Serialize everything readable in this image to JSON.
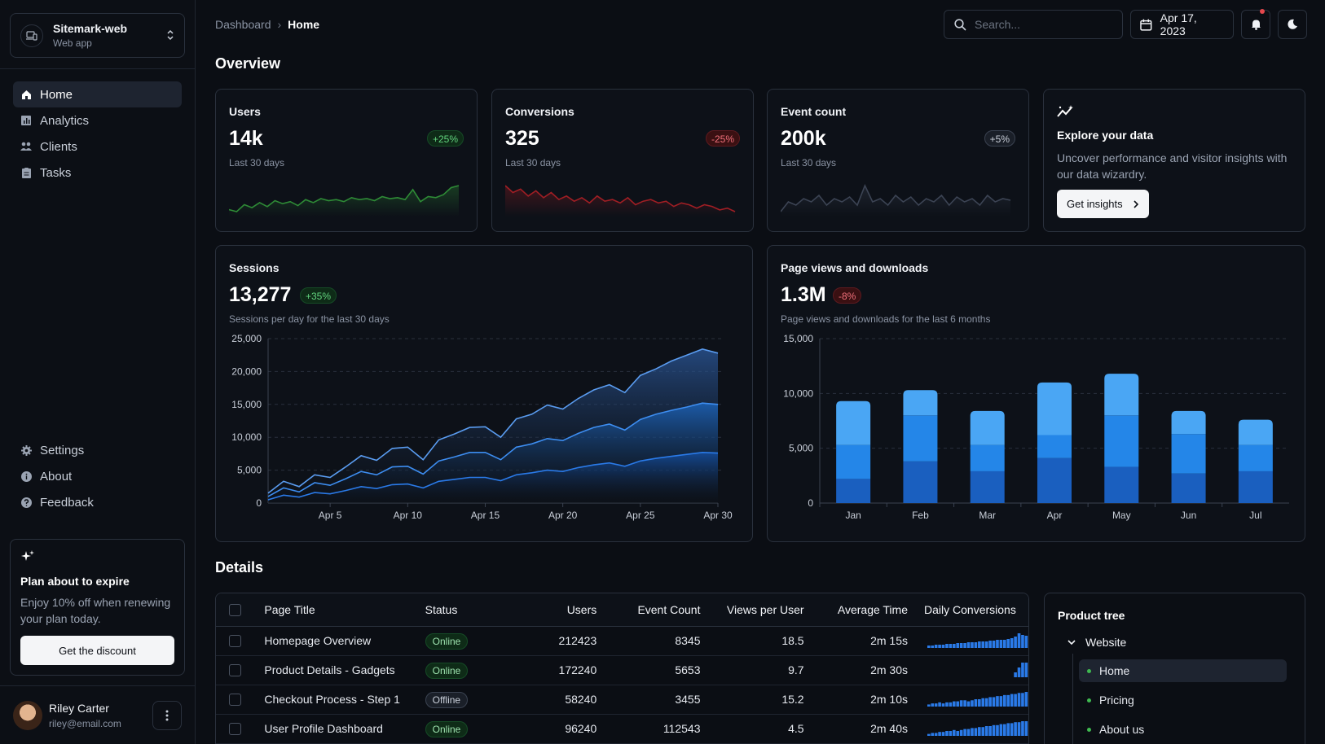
{
  "app": {
    "name": "Sitemark-web",
    "subtitle": "Web app"
  },
  "nav": {
    "main": [
      {
        "label": "Home",
        "icon": "home-icon",
        "active": true
      },
      {
        "label": "Analytics",
        "icon": "analytics-icon"
      },
      {
        "label": "Clients",
        "icon": "clients-icon"
      },
      {
        "label": "Tasks",
        "icon": "tasks-icon"
      }
    ],
    "secondary": [
      {
        "label": "Settings",
        "icon": "gear-icon"
      },
      {
        "label": "About",
        "icon": "info-icon"
      },
      {
        "label": "Feedback",
        "icon": "help-icon"
      }
    ]
  },
  "promo": {
    "title": "Plan about to expire",
    "text": "Enjoy 10% off when renewing your plan today.",
    "button": "Get the discount"
  },
  "user": {
    "name": "Riley Carter",
    "email": "riley@email.com"
  },
  "breadcrumb": {
    "root": "Dashboard",
    "current": "Home"
  },
  "search": {
    "placeholder": "Search..."
  },
  "date": "Apr 17, 2023",
  "overview": {
    "title": "Overview"
  },
  "stats": [
    {
      "label": "Users",
      "value": "14k",
      "trend": "+25%",
      "trend_type": "pos",
      "sub": "Last 30 days",
      "color": "#2e8b36",
      "series": [
        200,
        180,
        250,
        220,
        270,
        230,
        290,
        260,
        280,
        240,
        300,
        270,
        310,
        290,
        300,
        280,
        320,
        300,
        310,
        290,
        330,
        310,
        320,
        300,
        400,
        280,
        330,
        320,
        350,
        420,
        440
      ]
    },
    {
      "label": "Conversions",
      "value": "325",
      "trend": "-25%",
      "trend_type": "neg",
      "sub": "Last 30 days",
      "color": "#a01e24",
      "series": [
        560,
        520,
        540,
        500,
        530,
        490,
        520,
        480,
        500,
        470,
        490,
        460,
        500,
        470,
        480,
        460,
        490,
        450,
        470,
        480,
        460,
        470,
        440,
        460,
        450,
        430,
        450,
        440,
        420,
        430,
        410
      ]
    },
    {
      "label": "Event count",
      "value": "200k",
      "trend": "+5%",
      "trend_type": "neu",
      "sub": "Last 30 days",
      "color": "#3c4454",
      "series": [
        400,
        430,
        420,
        440,
        430,
        450,
        420,
        440,
        430,
        445,
        420,
        480,
        430,
        440,
        420,
        450,
        430,
        445,
        420,
        440,
        430,
        450,
        420,
        445,
        430,
        440,
        420,
        450,
        430,
        440,
        435
      ]
    }
  ],
  "explore": {
    "title": "Explore your data",
    "text": "Uncover performance and visitor insights with our data wizardry.",
    "button": "Get insights"
  },
  "sessions": {
    "label": "Sessions",
    "value": "13,277",
    "trend": "+35%",
    "sub": "Sessions per day for the last 30 days"
  },
  "pageviews": {
    "label": "Page views and downloads",
    "value": "1.3M",
    "trend": "-8%",
    "sub": "Page views and downloads for the last 6 months"
  },
  "chart_data": [
    {
      "type": "area",
      "x": [
        "Apr 1",
        "Apr 2",
        "Apr 3",
        "Apr 4",
        "Apr 5",
        "Apr 6",
        "Apr 7",
        "Apr 8",
        "Apr 9",
        "Apr 10",
        "Apr 11",
        "Apr 12",
        "Apr 13",
        "Apr 14",
        "Apr 15",
        "Apr 16",
        "Apr 17",
        "Apr 18",
        "Apr 19",
        "Apr 20",
        "Apr 21",
        "Apr 22",
        "Apr 23",
        "Apr 24",
        "Apr 25",
        "Apr 26",
        "Apr 27",
        "Apr 28",
        "Apr 29",
        "Apr 30"
      ],
      "xticks": [
        "Apr 5",
        "Apr 10",
        "Apr 15",
        "Apr 20",
        "Apr 25",
        "Apr 30"
      ],
      "ylim": [
        0,
        25000
      ],
      "yticks": [
        "0",
        "5,000",
        "10,000",
        "15,000",
        "20,000",
        "25,000"
      ],
      "series": [
        {
          "values": [
            1500,
            3300,
            2500,
            4300,
            3900,
            5500,
            7200,
            6500,
            8300,
            8500,
            6600,
            9600,
            10500,
            11500,
            11600,
            10000,
            12800,
            13500,
            14900,
            14300,
            15900,
            17200,
            18000,
            16800,
            19400,
            20400,
            21600,
            22500,
            23400,
            22800
          ]
        },
        {
          "values": [
            1000,
            2300,
            1700,
            3100,
            2700,
            3700,
            4800,
            4300,
            5500,
            5600,
            4400,
            6400,
            7000,
            7700,
            7700,
            6600,
            8500,
            9000,
            9800,
            9500,
            10600,
            11500,
            12000,
            11100,
            12700,
            13500,
            14100,
            14600,
            15200,
            15000
          ]
        },
        {
          "values": [
            500,
            1200,
            900,
            1600,
            1400,
            1900,
            2500,
            2200,
            2800,
            2900,
            2300,
            3300,
            3600,
            3900,
            3900,
            3400,
            4300,
            4600,
            5000,
            4800,
            5400,
            5800,
            6100,
            5600,
            6400,
            6800,
            7100,
            7400,
            7700,
            7600
          ]
        }
      ],
      "grid": true
    },
    {
      "type": "bar",
      "categories": [
        "Jan",
        "Feb",
        "Mar",
        "Apr",
        "May",
        "Jun",
        "Jul"
      ],
      "ylim": [
        0,
        15000
      ],
      "yticks": [
        "0",
        "5,000",
        "10,000",
        "15,000"
      ],
      "stacked": true,
      "series": [
        {
          "color": "#1a5fbf",
          "values": [
            2200,
            3800,
            2900,
            4100,
            3300,
            2700,
            2900
          ]
        },
        {
          "color": "#2486e8",
          "values": [
            3100,
            4200,
            2400,
            2100,
            4700,
            3600,
            2400
          ]
        },
        {
          "color": "#4aa6f4",
          "values": [
            4000,
            2300,
            3100,
            4800,
            3800,
            2100,
            2300
          ]
        }
      ],
      "grid": true
    }
  ],
  "details": {
    "title": "Details",
    "columns": [
      "Page Title",
      "Status",
      "Users",
      "Event Count",
      "Views per User",
      "Average Time",
      "Daily Conversions"
    ],
    "rows": [
      {
        "title": "Homepage Overview",
        "status": "Online",
        "users": "212423",
        "events": "8345",
        "views": "18.5",
        "time": "2m 15s",
        "spark": [
          3,
          3,
          4,
          4,
          4,
          5,
          5,
          5,
          6,
          6,
          6,
          7,
          7,
          7,
          8,
          8,
          8,
          9,
          9,
          10,
          10,
          10,
          11,
          12,
          14,
          18,
          16,
          15
        ]
      },
      {
        "title": "Product Details - Gadgets",
        "status": "Online",
        "users": "172240",
        "events": "5653",
        "views": "9.7",
        "time": "2m 30s",
        "spark": [
          0,
          0,
          0,
          0,
          0,
          0,
          0,
          0,
          0,
          0,
          0,
          0,
          0,
          0,
          0,
          0,
          0,
          0,
          0,
          0,
          0,
          0,
          0,
          0,
          4,
          8,
          12,
          12
        ]
      },
      {
        "title": "Checkout Process - Step 1",
        "status": "Offline",
        "users": "58240",
        "events": "3455",
        "views": "15.2",
        "time": "2m 10s",
        "spark": [
          2,
          3,
          3,
          4,
          3,
          4,
          4,
          5,
          5,
          6,
          6,
          5,
          6,
          7,
          7,
          8,
          8,
          9,
          9,
          10,
          10,
          11,
          11,
          12,
          12,
          13,
          13,
          14
        ]
      },
      {
        "title": "User Profile Dashboard",
        "status": "Online",
        "users": "96240",
        "events": "112543",
        "views": "4.5",
        "time": "2m 40s",
        "spark": [
          2,
          3,
          3,
          4,
          4,
          5,
          5,
          6,
          5,
          6,
          7,
          7,
          8,
          8,
          9,
          9,
          10,
          10,
          11,
          11,
          12,
          12,
          13,
          13,
          14,
          14,
          15,
          15
        ]
      }
    ]
  },
  "tree": {
    "title": "Product tree",
    "root": "Website",
    "items": [
      {
        "label": "Home",
        "active": true
      },
      {
        "label": "Pricing"
      },
      {
        "label": "About us"
      }
    ]
  }
}
